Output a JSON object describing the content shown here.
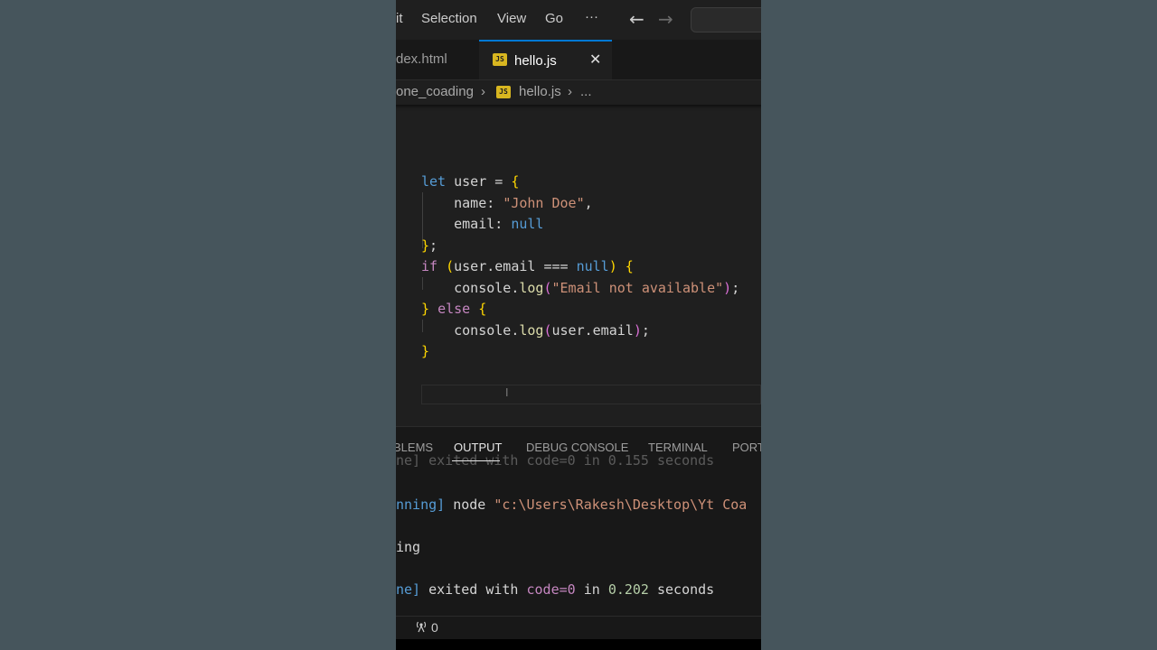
{
  "menu": {
    "items": [
      "it",
      "Selection",
      "View",
      "Go",
      "···"
    ],
    "back_icon": "←",
    "forward_icon": "→"
  },
  "tabs": {
    "inactive_label": "dex.html",
    "active_label": "hello.js",
    "active_icon_text": "JS",
    "close_glyph": "✕"
  },
  "breadcrumbs": {
    "folder": "one_coading",
    "sep1": "›",
    "file": "hello.js",
    "sep2": "›",
    "more": "..."
  },
  "editor": {
    "lines": [
      {
        "tokens": [
          {
            "t": "let",
            "c": "kw"
          },
          {
            "t": " user = "
          },
          {
            "t": "{",
            "c": "br1"
          }
        ]
      },
      {
        "tokens": [
          {
            "t": "    name: "
          },
          {
            "t": "\"John Doe\"",
            "c": "str"
          },
          {
            "t": ","
          }
        ]
      },
      {
        "tokens": [
          {
            "t": "    email: "
          },
          {
            "t": "null",
            "c": "kw"
          }
        ]
      },
      {
        "tokens": [
          {
            "t": "}",
            "c": "br1"
          },
          {
            "t": ";"
          }
        ]
      },
      {
        "tokens": [
          {
            "t": "if",
            "c": "kw2"
          },
          {
            "t": " "
          },
          {
            "t": "(",
            "c": "br1"
          },
          {
            "t": "user.email === "
          },
          {
            "t": "null",
            "c": "kw"
          },
          {
            "t": ")",
            "c": "br1"
          },
          {
            "t": " "
          },
          {
            "t": "{",
            "c": "br1"
          }
        ]
      },
      {
        "tokens": [
          {
            "t": "    console."
          },
          {
            "t": "log",
            "c": "fn"
          },
          {
            "t": "(",
            "c": "br2"
          },
          {
            "t": "\"Email not available\"",
            "c": "str"
          },
          {
            "t": ")",
            "c": "br2"
          },
          {
            "t": ";"
          }
        ]
      },
      {
        "tokens": [
          {
            "t": "}",
            "c": "br1"
          },
          {
            "t": " "
          },
          {
            "t": "else",
            "c": "kw2"
          },
          {
            "t": " "
          },
          {
            "t": "{",
            "c": "br1"
          }
        ]
      },
      {
        "tokens": [
          {
            "t": "    console."
          },
          {
            "t": "log",
            "c": "fn"
          },
          {
            "t": "(",
            "c": "br2"
          },
          {
            "t": "user.email"
          },
          {
            "t": ")",
            "c": "br2"
          },
          {
            "t": ";"
          }
        ]
      },
      {
        "tokens": [
          {
            "t": "}",
            "c": "br1"
          }
        ]
      }
    ]
  },
  "panel": {
    "tabs": [
      "BLEMS",
      "OUTPUT",
      "DEBUG CONSOLE",
      "TERMINAL",
      "PORT"
    ],
    "active_tab": "OUTPUT",
    "output_lines": [
      {
        "tokens": [
          {
            "t": "ne] exited with code=0 in 0.155 seconds",
            "c": "o-faded"
          }
        ]
      },
      {
        "tokens": [
          {
            "t": "nning]",
            "c": "o-blue"
          },
          {
            "t": " node "
          },
          {
            "t": "\"c:\\Users\\Rakesh\\Desktop\\Yt Coa",
            "c": "o-orange"
          }
        ]
      },
      {
        "tokens": [
          {
            "t": "ing"
          }
        ]
      },
      {
        "tokens": [
          {
            "t": "ne]",
            "c": "o-blue"
          },
          {
            "t": " exited with "
          },
          {
            "t": "code=0",
            "c": "o-purple"
          },
          {
            "t": " in "
          },
          {
            "t": "0.202",
            "c": "o-green"
          },
          {
            "t": " seconds"
          }
        ]
      }
    ]
  },
  "status": {
    "ports_icon": "antenna-icon",
    "ports_count": "0"
  },
  "colors": {
    "background_outer": "#46555c",
    "editor_bg": "#1f1f1f",
    "accent": "#0078d4"
  }
}
